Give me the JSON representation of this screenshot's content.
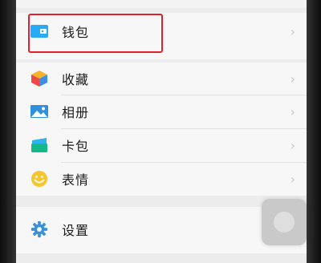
{
  "menu": {
    "wallet": {
      "label": "钱包",
      "icon": "wallet-icon"
    },
    "favorites": {
      "label": "收藏",
      "icon": "favorites-cube-icon"
    },
    "album": {
      "label": "相册",
      "icon": "album-image-icon"
    },
    "cards": {
      "label": "卡包",
      "icon": "card-pack-icon"
    },
    "stickers": {
      "label": "表情",
      "icon": "smiley-icon"
    },
    "settings": {
      "label": "设置",
      "icon": "gear-icon"
    }
  },
  "chevron": "›",
  "colors": {
    "highlight_border": "#e0202a",
    "wallet_icon": "#29aaf5",
    "settings_icon": "#3a8fd9"
  }
}
